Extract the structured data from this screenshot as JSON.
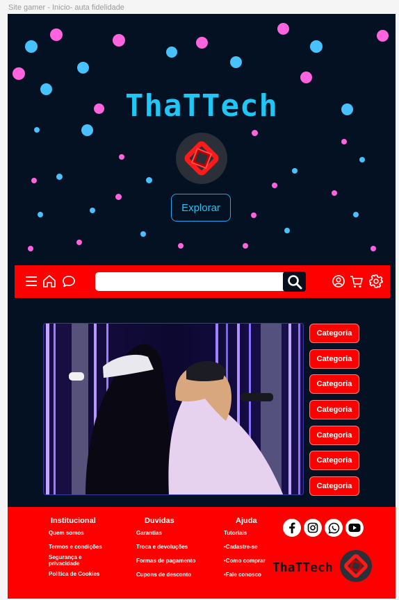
{
  "frame": {
    "label": "Site gamer - Inicio- auta fidelidade"
  },
  "hero": {
    "brand": "ThaTTech",
    "explore_label": "Explorar"
  },
  "navbar": {
    "search": {
      "placeholder": ""
    },
    "icons": [
      "menu-icon",
      "home-icon",
      "chat-icon",
      "search-icon",
      "user-icon",
      "cart-icon",
      "gear-icon"
    ]
  },
  "banner": {
    "image": "two people wearing VR headsets back to back in neon-lit room"
  },
  "categories": {
    "items": [
      "Categoria",
      "Categoria",
      "Categoria",
      "Categoria",
      "Categoria",
      "Categoria",
      "Categoria"
    ]
  },
  "footer": {
    "institucional": {
      "title": "Institucional",
      "links": [
        "Quem somos",
        "Termos e condições",
        "Segurança e privacidade",
        "Política de Cookies"
      ]
    },
    "duvidas": {
      "title": "Duvidas",
      "links": [
        "Garantias",
        "Troca e devoluções",
        "Formas de pagamento",
        "Cupons de desconto"
      ]
    },
    "ajuda": {
      "title": "Ajuda",
      "links": [
        "Tutoriais",
        "•Cadastre-se",
        "•Como comprar",
        "•Fale conosco"
      ]
    },
    "social": [
      "facebook-icon",
      "instagram-icon",
      "whatsapp-icon",
      "youtube-icon"
    ],
    "brand": "ThaTTech"
  },
  "colors": {
    "accent_red": "#ff0000",
    "background": "#031122",
    "brand_cyan": "#1ec7f5",
    "dot_blue": "#47c1ff",
    "dot_pink": "#ff63de"
  }
}
